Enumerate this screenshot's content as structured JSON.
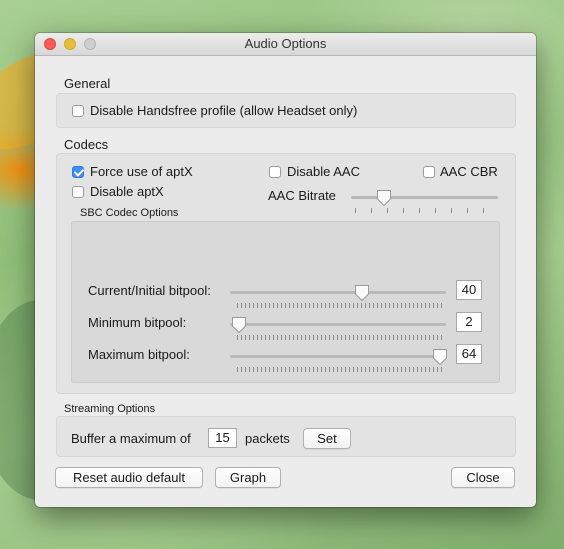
{
  "window": {
    "title": "Audio Options"
  },
  "general": {
    "heading": "General",
    "disable_handsfree": {
      "label": "Disable Handsfree profile (allow Headset only)",
      "checked": false
    }
  },
  "codecs": {
    "heading": "Codecs",
    "force_aptx": {
      "label": "Force use of aptX",
      "checked": true
    },
    "disable_aptx": {
      "label": "Disable aptX",
      "checked": false
    },
    "disable_aac": {
      "label": "Disable AAC",
      "checked": false
    },
    "aac_cbr": {
      "label": "AAC CBR",
      "checked": false
    },
    "aac_bitrate": {
      "label": "AAC Bitrate",
      "level": 0.18
    }
  },
  "sbc": {
    "heading": "SBC Codec Options",
    "current": {
      "label": "Current/Initial bitpool:",
      "value": "40",
      "level": 0.61
    },
    "minimum": {
      "label": "Minimum bitpool:",
      "value": "2",
      "level": 0.0
    },
    "maximum": {
      "label": "Maximum bitpool:",
      "value": "64",
      "level": 1.0
    }
  },
  "streaming": {
    "heading": "Streaming Options",
    "buffer_prefix": "Buffer a maximum of",
    "buffer_value": "15",
    "buffer_suffix": "packets",
    "set_label": "Set"
  },
  "buttons": {
    "reset": "Reset audio default",
    "graph": "Graph",
    "close": "Close"
  }
}
